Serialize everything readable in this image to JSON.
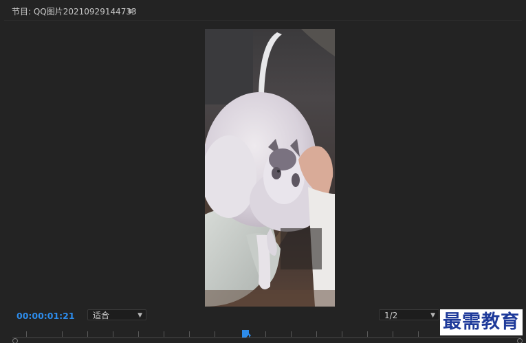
{
  "panel": {
    "title": "节目: QQ图片20210929144733",
    "menu_icon": "≡"
  },
  "viewer": {
    "image_description_icon": "video-frame-cat-icon"
  },
  "controls": {
    "timecode": "00:00:01:21",
    "fit_dropdown": {
      "selected": "适合"
    },
    "resolution_dropdown": {
      "selected": "1/2"
    }
  },
  "watermark": {
    "text": "最需教育"
  },
  "colors": {
    "timecode": "#2d8ceb",
    "panel_bg": "#232323",
    "playhead": "#2d8ceb",
    "watermark_text": "#1e3a9a"
  }
}
